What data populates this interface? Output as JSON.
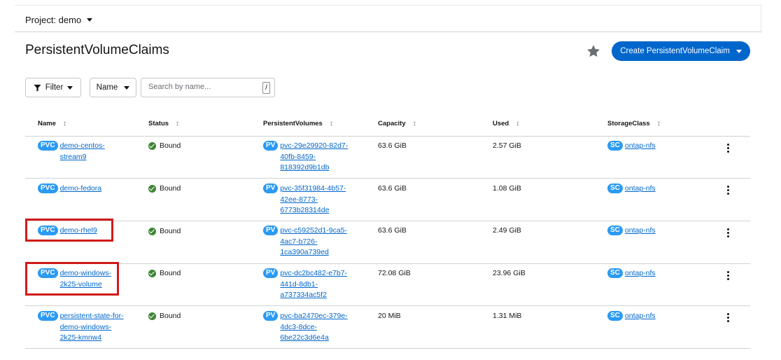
{
  "project": {
    "label": "Project: demo"
  },
  "page": {
    "title": "PersistentVolumeClaims"
  },
  "toolbar": {
    "create_label": "Create PersistentVolumeClaim",
    "filter_label": "Filter",
    "name_label": "Name",
    "search_placeholder": "Search by name...",
    "search_shortcut": "/"
  },
  "table": {
    "headers": [
      "Name",
      "Status",
      "PersistentVolumes",
      "Capacity",
      "Used",
      "StorageClass"
    ],
    "rows": [
      {
        "pvc_badge": "PVC",
        "name": "demo-centos-\nstream9",
        "status": "Bound",
        "pv_badge": "PV",
        "pv": "pvc-29e29920-82d7-\n40fb-8459-\n818392d9b1db",
        "capacity": "63.6 GiB",
        "used": "2.57 GiB",
        "sc_badge": "SC",
        "storage_class": "ontap-nfs"
      },
      {
        "pvc_badge": "PVC",
        "name": "demo-fedora",
        "status": "Bound",
        "pv_badge": "PV",
        "pv": "pvc-35f31984-4b57-\n42ee-8773-\n6773b28314de",
        "capacity": "63.6 GiB",
        "used": "1.08 GiB",
        "sc_badge": "SC",
        "storage_class": "ontap-nfs"
      },
      {
        "pvc_badge": "PVC",
        "name": "demo-rhel9",
        "status": "Bound",
        "pv_badge": "PV",
        "pv": "pvc-c59252d1-9ca5-\n4ac7-b726-\n1ca390a739ed",
        "capacity": "63.6 GiB",
        "used": "2.49 GiB",
        "sc_badge": "SC",
        "storage_class": "ontap-nfs"
      },
      {
        "pvc_badge": "PVC",
        "name": "demo-windows-\n2k25-volume",
        "status": "Bound",
        "pv_badge": "PV",
        "pv": "pvc-dc2bc482-e7b7-\n441d-8db1-\na737334ac5f2",
        "capacity": "72.08 GiB",
        "used": "23.96 GiB",
        "sc_badge": "SC",
        "storage_class": "ontap-nfs"
      },
      {
        "pvc_badge": "PVC",
        "name": "persistent-state-for-\ndemo-windows-\n2k25-kmnw4",
        "status": "Bound",
        "pv_badge": "PV",
        "pv": "pvc-ba2470ec-379e-\n4dc3-8dce-\n6be22c3d6e4a",
        "capacity": "20 MiB",
        "used": "1.31 MiB",
        "sc_badge": "SC",
        "storage_class": "ontap-nfs"
      }
    ]
  },
  "colors": {
    "accent": "#0066cc",
    "badge": "#2b9af3",
    "bound": "#3e8635",
    "highlight": "#d11a1a"
  },
  "icons": [
    "caret-down-icon",
    "star-icon",
    "filter-icon",
    "sort-icon",
    "check-circle-icon",
    "kebab-icon"
  ]
}
